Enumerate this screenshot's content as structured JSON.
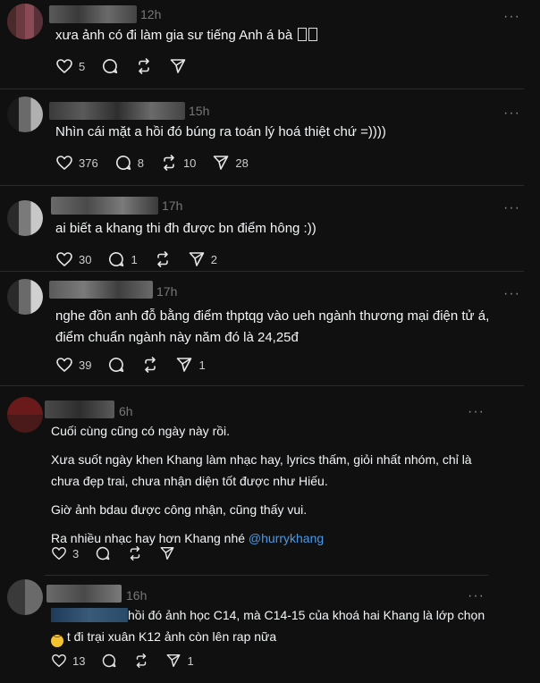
{
  "posts": [
    {
      "time": "12h",
      "lines": [
        "xưa ảnh có đi làm gia sư tiếng Anh á bà"
      ],
      "likes": "5",
      "replies": "",
      "reposts": "",
      "shares": ""
    },
    {
      "time": "15h",
      "lines": [
        "Nhìn cái mặt a hồi đó búng ra toán lý hoá thiệt chứ =))))"
      ],
      "likes": "376",
      "replies": "8",
      "reposts": "10",
      "shares": "28"
    },
    {
      "time": "17h",
      "lines": [
        "ai biết a khang thi đh được bn điểm hông :))"
      ],
      "likes": "30",
      "replies": "1",
      "reposts": "",
      "shares": "2"
    },
    {
      "time": "17h",
      "lines": [
        "nghe đồn anh đỗ bằng điểm thptqg vào ueh ngành thương mại điện tử á,",
        "điểm chuẩn ngành này năm đó là 24,25đ"
      ],
      "likes": "39",
      "replies": "",
      "reposts": "",
      "shares": "1"
    },
    {
      "time": "6h",
      "paragraphs": [
        "Cuối cùng cũng có ngày này rồi.",
        "Xưa suốt ngày khen Khang làm nhạc hay, lyrics thấm, giỏi nhất nhóm, chỉ là",
        "chưa đẹp trai, chưa nhận diện tốt được như Hiếu.",
        "Giờ ảnh bdau được công nhận, cũng thấy vui.",
        "Ra nhiều nhạc hay hơn Khang nhé"
      ],
      "mention": "@hurrykhang",
      "likes": "3",
      "replies": "",
      "reposts": "",
      "shares": ""
    },
    {
      "time": "16h",
      "lines": [
        "hồi đó ảnh học C14, mà C14-15 của khoá hai Khang là lớp chọn",
        "t đi trại xuân K12 ảnh còn lên rap nữa"
      ],
      "likes": "13",
      "replies": "",
      "reposts": "",
      "shares": "1"
    }
  ],
  "more_label": "···",
  "colors": {
    "background": "#101010",
    "text": "#f3f5f7",
    "muted": "#777777",
    "mention": "#4a9ae8",
    "divider": "#2b2b2b"
  },
  "icons": [
    "heart-icon",
    "comment-icon",
    "repost-icon",
    "share-icon",
    "more-icon"
  ]
}
